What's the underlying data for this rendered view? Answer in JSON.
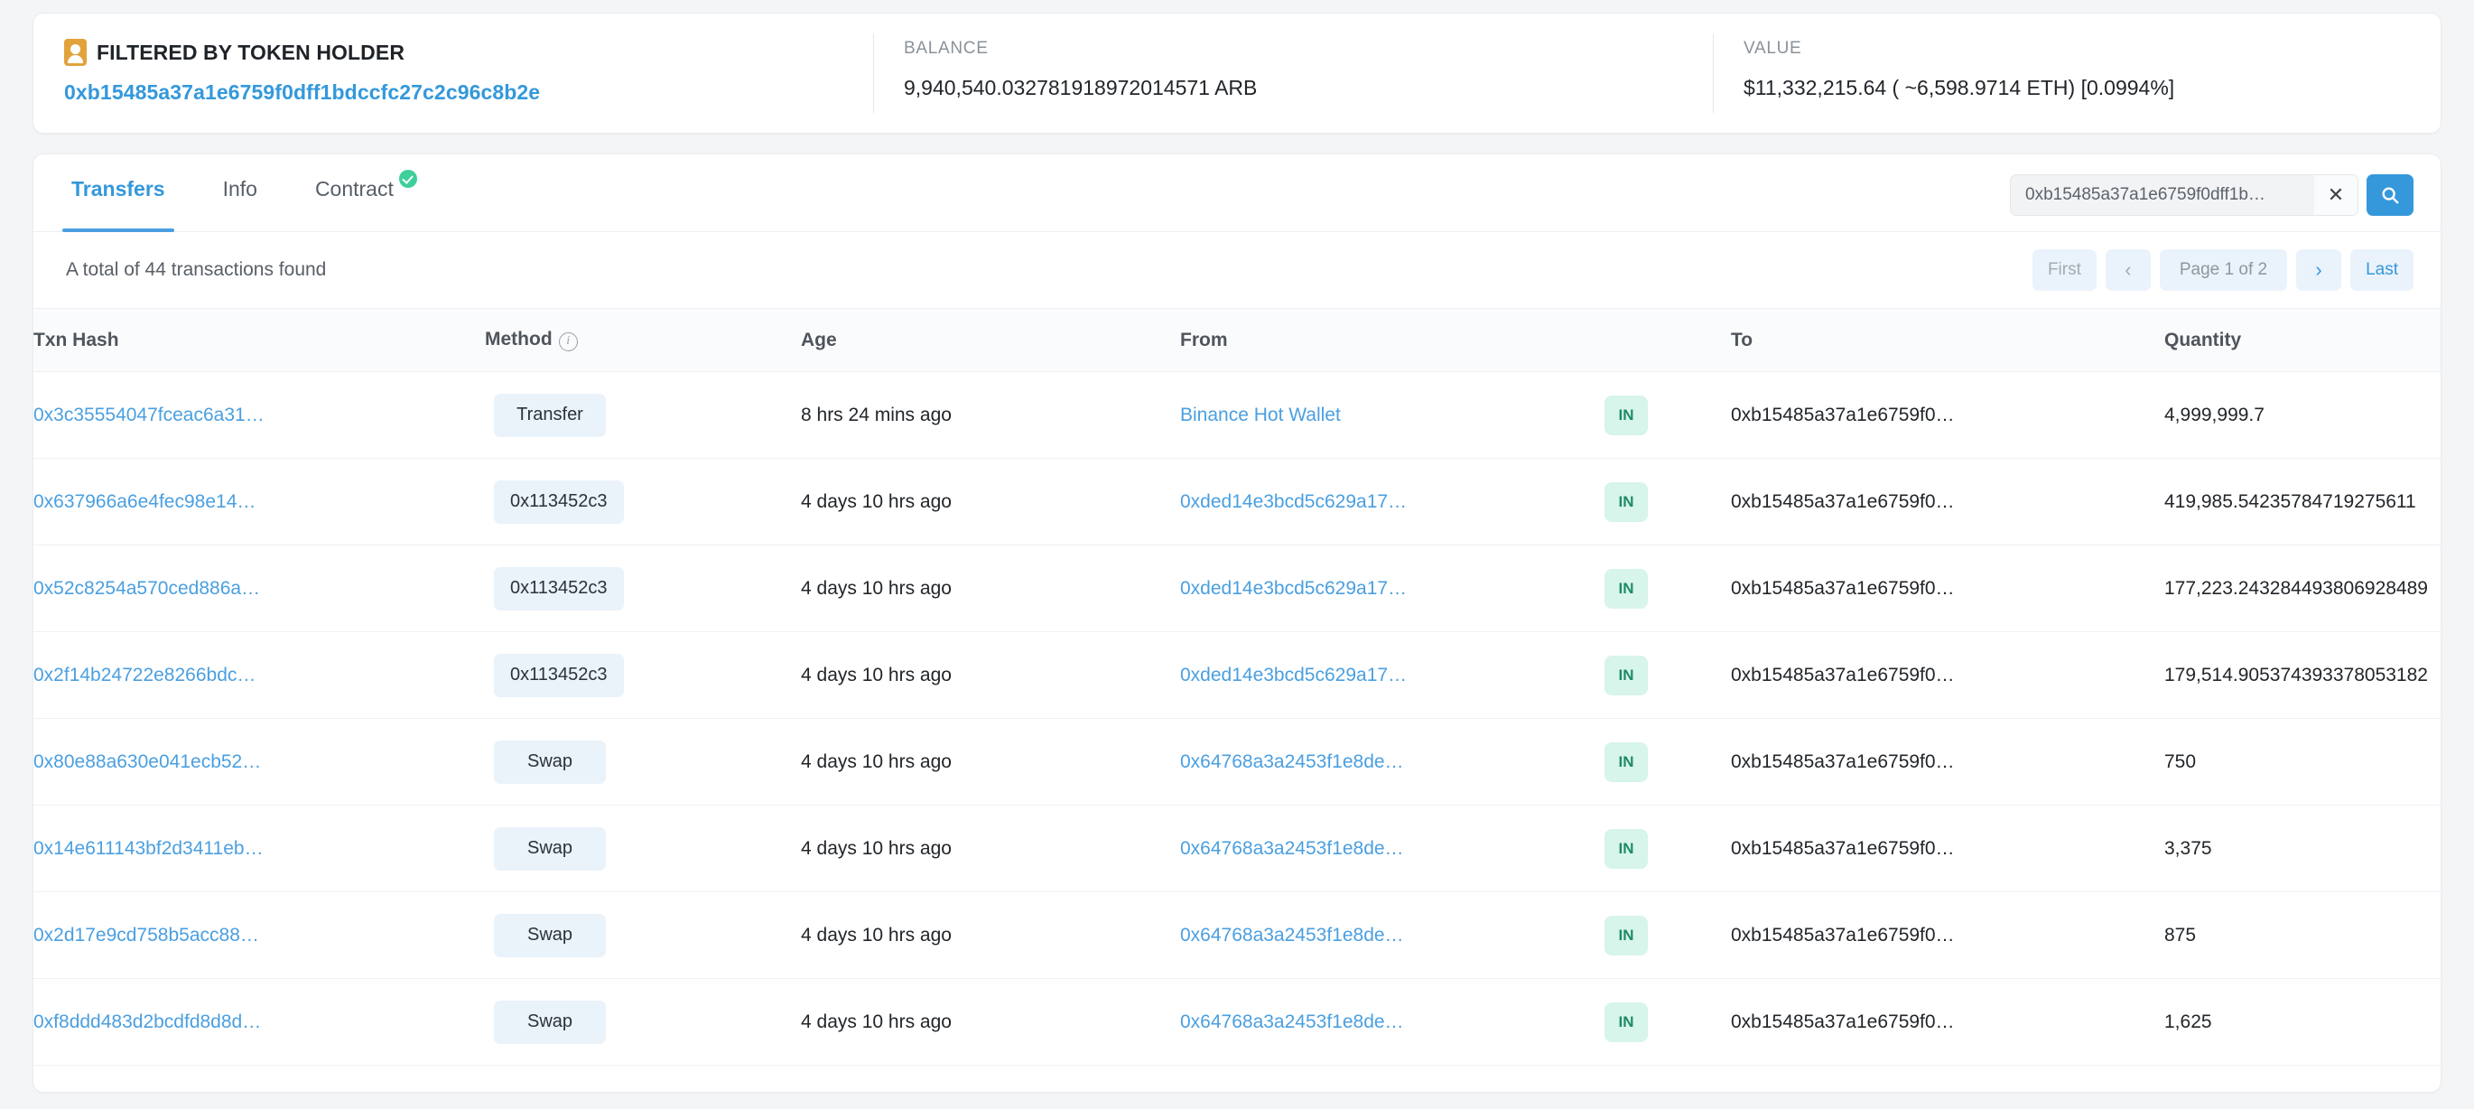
{
  "summary": {
    "holder": {
      "icon": "addressbook-icon",
      "label": "FILTERED BY TOKEN HOLDER",
      "address": "0xb15485a37a1e6759f0dff1bdccfc27c2c96c8b2e"
    },
    "balance": {
      "label": "BALANCE",
      "value": "9,940,540.032781918972014571 ARB"
    },
    "value": {
      "label": "VALUE",
      "value": "$11,332,215.64 ( ~6,598.9714 ETH) [0.0994%]"
    }
  },
  "tabs": [
    {
      "label": "Transfers",
      "active": true,
      "verified": false
    },
    {
      "label": "Info",
      "active": false,
      "verified": false
    },
    {
      "label": "Contract",
      "active": false,
      "verified": true
    }
  ],
  "search": {
    "value": "0xb15485a37a1e6759f0dff1b…",
    "placeholder": "Search",
    "clear_label": "✕",
    "search_icon": "search-icon"
  },
  "results": {
    "count_text": "A total of 44 transactions found"
  },
  "pagination": {
    "first": "First",
    "prev": "‹",
    "page_indicator": "Page 1 of 2",
    "next": "›",
    "last": "Last"
  },
  "table": {
    "columns": [
      {
        "label": "Txn Hash",
        "sortable": false,
        "info": false
      },
      {
        "label": "Method",
        "sortable": false,
        "info": true
      },
      {
        "label": "Age",
        "sortable": true,
        "info": false
      },
      {
        "label": "From",
        "sortable": false,
        "info": false
      },
      {
        "label": "",
        "sortable": false,
        "info": false
      },
      {
        "label": "To",
        "sortable": false,
        "info": false
      },
      {
        "label": "Quantity",
        "sortable": false,
        "info": false
      }
    ],
    "rows": [
      {
        "hash": "0x3c35554047fceac6a31…",
        "method": "Transfer",
        "age": "8 hrs 24 mins ago",
        "from": "Binance Hot Wallet",
        "direction": "IN",
        "to": "0xb15485a37a1e6759f0…",
        "quantity": "4,999,999.7"
      },
      {
        "hash": "0x637966a6e4fec98e14…",
        "method": "0x113452c3",
        "age": "4 days 10 hrs ago",
        "from": "0xded14e3bcd5c629a17…",
        "direction": "IN",
        "to": "0xb15485a37a1e6759f0…",
        "quantity": "419,985.54235784719275611"
      },
      {
        "hash": "0x52c8254a570ced886a…",
        "method": "0x113452c3",
        "age": "4 days 10 hrs ago",
        "from": "0xded14e3bcd5c629a17…",
        "direction": "IN",
        "to": "0xb15485a37a1e6759f0…",
        "quantity": "177,223.243284493806928489"
      },
      {
        "hash": "0x2f14b24722e8266bdc…",
        "method": "0x113452c3",
        "age": "4 days 10 hrs ago",
        "from": "0xded14e3bcd5c629a17…",
        "direction": "IN",
        "to": "0xb15485a37a1e6759f0…",
        "quantity": "179,514.905374393378053182"
      },
      {
        "hash": "0x80e88a630e041ecb52…",
        "method": "Swap",
        "age": "4 days 10 hrs ago",
        "from": "0x64768a3a2453f1e8de…",
        "direction": "IN",
        "to": "0xb15485a37a1e6759f0…",
        "quantity": "750"
      },
      {
        "hash": "0x14e611143bf2d3411eb…",
        "method": "Swap",
        "age": "4 days 10 hrs ago",
        "from": "0x64768a3a2453f1e8de…",
        "direction": "IN",
        "to": "0xb15485a37a1e6759f0…",
        "quantity": "3,375"
      },
      {
        "hash": "0x2d17e9cd758b5acc88…",
        "method": "Swap",
        "age": "4 days 10 hrs ago",
        "from": "0x64768a3a2453f1e8de…",
        "direction": "IN",
        "to": "0xb15485a37a1e6759f0…",
        "quantity": "875"
      },
      {
        "hash": "0xf8ddd483d2bcdfd8d8d…",
        "method": "Swap",
        "age": "4 days 10 hrs ago",
        "from": "0x64768a3a2453f1e8de…",
        "direction": "IN",
        "to": "0xb15485a37a1e6759f0…",
        "quantity": "1,625"
      }
    ]
  },
  "colors": {
    "accent": "#3498db",
    "link": "#4a9fe0",
    "badge_bg": "#eaf2fa",
    "in_badge_bg": "#d7f5ea",
    "in_badge_text": "#1f8a68",
    "verified_green": "#3ecf9a",
    "icon_gold": "#e2a33c"
  }
}
